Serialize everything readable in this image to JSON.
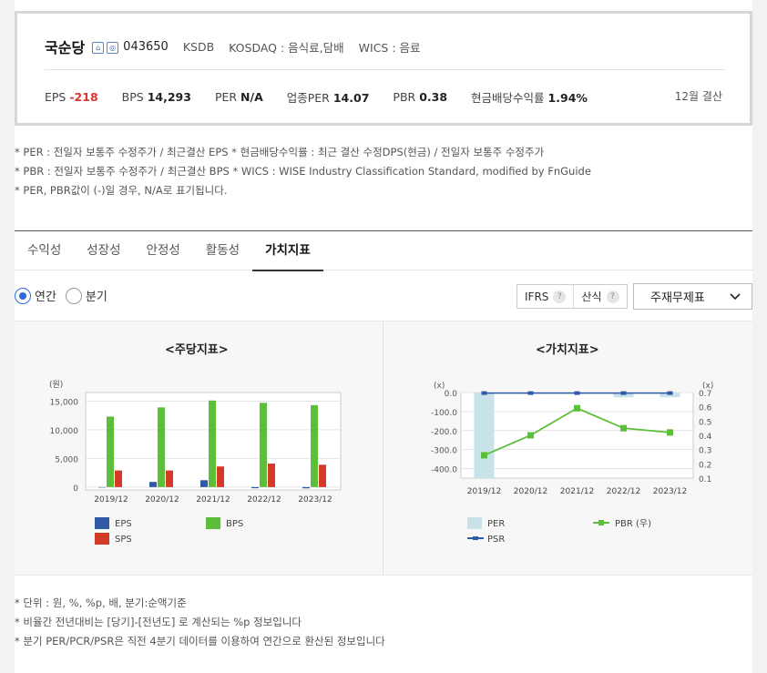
{
  "header": {
    "company": "국순당",
    "icon1": "home-icon",
    "icon2": "report-icon",
    "code": "043650",
    "ksdb": "KSDB",
    "market": "KOSDAQ : 음식료,담배",
    "wics": "WICS : 음료",
    "settlement": "12월 결산",
    "metrics": [
      {
        "label": "EPS",
        "value": "-218"
      },
      {
        "label": "BPS",
        "value": "14,293"
      },
      {
        "label": "PER",
        "value": "N/A"
      },
      {
        "label": "업종PER",
        "value": "14.07"
      },
      {
        "label": "PBR",
        "value": "0.38"
      },
      {
        "label": "현금배당수익률",
        "value": "1.94%"
      }
    ]
  },
  "notes": [
    "* PER : 전일자 보통주 수정주가 / 최근결산 EPS * 현금배당수익률 : 최근 결산 수정DPS(현금) / 전일자 보통주 수정주가",
    "* PBR : 전일자 보통주 수정주가 / 최근결산 BPS * WICS : WISE Industry Classification Standard, modified by FnGuide",
    "* PER, PBR값이 (-)일 경우, N/A로 표기됩니다."
  ],
  "tabs": [
    "수익성",
    "성장성",
    "안정성",
    "활동성",
    "가치지표"
  ],
  "active_tab": "가치지표",
  "period": {
    "annual": "연간",
    "quarter": "분기",
    "selected": "연간"
  },
  "buttons": {
    "ifrs": "IFRS",
    "calc": "산식",
    "help": "?"
  },
  "select": {
    "value": "주재무제표"
  },
  "colors": {
    "eps": "#2f5aa8",
    "bps": "#5cbf3a",
    "sps": "#d43a2a",
    "per": "#c8e2ea",
    "pbr": "#5cbf3a",
    "psr": "#2f5aa8"
  },
  "chart_data": [
    {
      "type": "bar",
      "title": "<주당지표>",
      "unit": "(원)",
      "categories": [
        "2019/12",
        "2020/12",
        "2021/12",
        "2022/12",
        "2023/12"
      ],
      "yticks": [
        "15,000",
        "10,000",
        "5,000",
        "0"
      ],
      "ylim": [
        -500,
        16500
      ],
      "grid": true,
      "series": [
        {
          "name": "EPS",
          "values": [
            0,
            900,
            1200,
            -200,
            -218
          ]
        },
        {
          "name": "BPS",
          "values": [
            12300,
            13900,
            15100,
            14700,
            14293
          ]
        },
        {
          "name": "SPS",
          "values": [
            2900,
            2900,
            3600,
            4100,
            3900
          ]
        }
      ]
    },
    {
      "type": "bar",
      "title": "<가치지표>",
      "left_unit": "(x)",
      "right_unit": "(x)",
      "categories": [
        "2019/12",
        "2020/12",
        "2021/12",
        "2022/12",
        "2023/12"
      ],
      "yticks_left": [
        "0.0",
        "-100.0",
        "-200.0",
        "-300.0",
        "-400.0"
      ],
      "yticks_right": [
        "0.7",
        "0.6",
        "0.5",
        "0.4",
        "0.3",
        "0.2",
        "0.1"
      ],
      "ylim_left": [
        -450,
        0
      ],
      "ylim_right": [
        0.1,
        0.7
      ],
      "grid": true,
      "series": [
        {
          "name": "PER",
          "type": "bar",
          "axis": "left",
          "values": [
            -450,
            -5,
            -5,
            -25,
            -25
          ]
        },
        {
          "name": "PBR (우)",
          "type": "line",
          "axis": "right",
          "values": [
            0.26,
            0.4,
            0.59,
            0.45,
            0.42
          ]
        },
        {
          "name": "PSR",
          "type": "line",
          "axis": "left",
          "values": [
            -3,
            -3,
            -3,
            -3,
            -3
          ]
        }
      ]
    }
  ],
  "footnotes": [
    "* 단위 : 원, %, %p, 배, 분기:순액기준",
    "* 비율간 전년대비는 [당기]-[전년도] 로 계산되는 %p 정보입니다",
    "* 분기 PER/PCR/PSR은 직전 4분기 데이터를 이용하여 연간으로 환산된 정보입니다"
  ]
}
